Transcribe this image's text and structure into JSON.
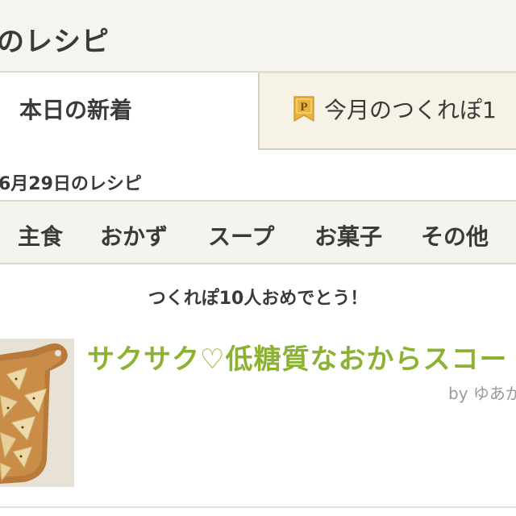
{
  "header": {
    "title": "のレシピ"
  },
  "tabs": [
    {
      "label": "本日の新着",
      "active": true
    },
    {
      "label": "今月のつくれぽ1",
      "badge_icon": "p-ribbon-badge-icon",
      "active": false
    }
  ],
  "date_heading": "6月29日のレシピ",
  "categories": [
    "主食",
    "おかず",
    "スープ",
    "お菓子",
    "その他"
  ],
  "congrats_message": "つくれぽ10人おめでとう！",
  "recipe": {
    "title": "サクサク♡低糖質なおからスコー",
    "author": "by ゆあか",
    "thumbnail_icon": "scone-on-cutting-board-photo"
  },
  "colors": {
    "header_bg": "#f6f4ef",
    "tab_inactive_bg": "#f6f2e6",
    "category_bar_bg": "#f5f3ee",
    "recipe_title": "#8bb233",
    "badge_gold": "#e9b43c",
    "text": "#3a3a3a",
    "muted_text": "#9a9a9a"
  }
}
